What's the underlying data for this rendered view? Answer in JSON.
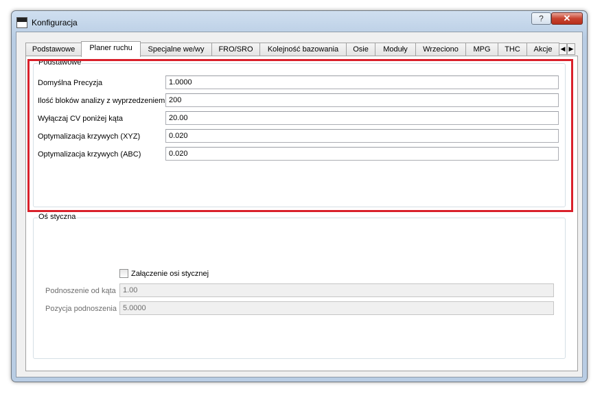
{
  "window": {
    "title": "Konfiguracja",
    "help_label": "?",
    "close_label": "✕",
    "app_icon_text": "IIICNC"
  },
  "tabs": [
    {
      "label": "Podstawowe"
    },
    {
      "label": "Planer ruchu"
    },
    {
      "label": "Specjalne we/wy"
    },
    {
      "label": "FRO/SRO"
    },
    {
      "label": "Kolejność bazowania"
    },
    {
      "label": "Osie"
    },
    {
      "label": "Moduły"
    },
    {
      "label": "Wrzeciono"
    },
    {
      "label": "MPG"
    },
    {
      "label": "THC"
    },
    {
      "label": "Akcje"
    }
  ],
  "active_tab": "Planer ruchu",
  "tab_scroll": {
    "left": "◀",
    "right": "▶"
  },
  "group_basic": {
    "title": "Podstawowe",
    "rows": [
      {
        "label": "Domyślna Precyzja",
        "value": "1.0000"
      },
      {
        "label": "Ilość bloków analizy z wyprzedzeniem",
        "value": "200"
      },
      {
        "label": "Wyłączaj CV poniżej kąta",
        "value": "20.00"
      },
      {
        "label": "Optymalizacja krzywych (XYZ)",
        "value": "0.020"
      },
      {
        "label": "Optymalizacja krzywych (ABC)",
        "value": "0.020"
      }
    ]
  },
  "group_tangent": {
    "title": "Oś styczna",
    "checkbox_label": "Załączenie osi stycznej",
    "checked": false,
    "rows": [
      {
        "label": "Podnoszenie od kąta",
        "value": "1.00"
      },
      {
        "label": "Pozycja podnoszenia",
        "value": "5.0000"
      }
    ]
  },
  "colors": {
    "highlight_border": "#d9202a",
    "close_button": "#c8432f"
  }
}
